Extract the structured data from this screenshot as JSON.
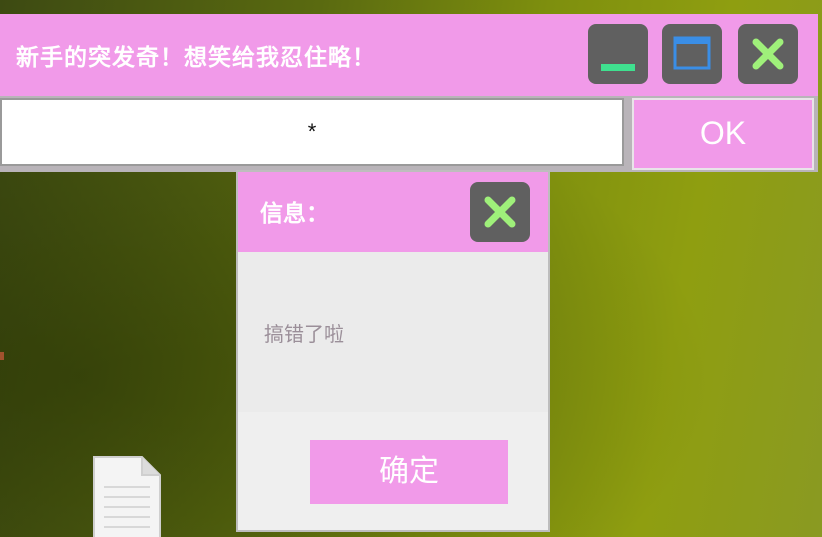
{
  "main_window": {
    "title": "新手的突发奇！想笑给我忍住略！",
    "controls": {
      "minimize_icon": "minimize-icon",
      "maximize_icon": "maximize-icon",
      "close_icon": "close-icon"
    },
    "input": {
      "value": "*"
    },
    "ok_label": "OK"
  },
  "dialog": {
    "title": "信息：",
    "close_icon": "close-icon",
    "message": "搞错了啦",
    "confirm_label": "确定"
  },
  "desktop": {
    "file_icon": "document-icon"
  },
  "colors": {
    "accent_pink": "#f19ae9",
    "button_gray": "#606060",
    "minimize_green": "#3fe08f",
    "maximize_blue": "#3a8ee6",
    "close_green": "#9ff07a",
    "desktop_olive": "#7e8f0e"
  }
}
